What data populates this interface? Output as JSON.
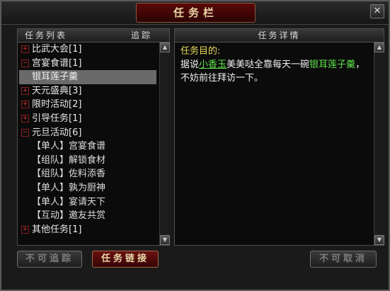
{
  "window": {
    "title": "任务栏"
  },
  "left_panel": {
    "header_left": "任务列表",
    "header_right": "追踪",
    "items": [
      {
        "label": "比武大会[1]",
        "type": "category"
      },
      {
        "label": "宫宴食谱[1]",
        "type": "category-open"
      },
      {
        "label": "银耳莲子羹",
        "type": "quest",
        "selected": true
      },
      {
        "label": "天元盛典[3]",
        "type": "category"
      },
      {
        "label": "限时活动[2]",
        "type": "category"
      },
      {
        "label": "引导任务[1]",
        "type": "category"
      },
      {
        "label": "元旦活动[6]",
        "type": "category-open"
      },
      {
        "label": "【单人】宫宴食谱",
        "type": "child"
      },
      {
        "label": "【组队】解锁食材",
        "type": "child"
      },
      {
        "label": "【组队】佐料添香",
        "type": "child"
      },
      {
        "label": "【单人】孰为厨神",
        "type": "child"
      },
      {
        "label": "【单人】宴请天下",
        "type": "child"
      },
      {
        "label": "【互动】邀友共赏",
        "type": "child"
      },
      {
        "label": "其他任务[1]",
        "type": "category"
      }
    ]
  },
  "right_panel": {
    "header": "任务详情",
    "goal_label": "任务目的:",
    "desc_prefix": "据说",
    "npc_name": "小香玉",
    "desc_middle": "美美哒全靠每天一碗",
    "item_name": "银耳莲子羹",
    "desc_suffix": "，不妨前往拜访一下。"
  },
  "buttons": {
    "untrack": "不可追踪",
    "link": "任务链接",
    "cancel": "不可取消"
  },
  "icons": {
    "expand": "plus-box-icon",
    "close": "close-icon",
    "scroll_up": "arrow-up-icon",
    "scroll_down": "arrow-down-icon"
  },
  "colors": {
    "highlight_green": "#5ee24a",
    "goal_yellow": "#e8d95a",
    "title_red": "#5a0808"
  }
}
